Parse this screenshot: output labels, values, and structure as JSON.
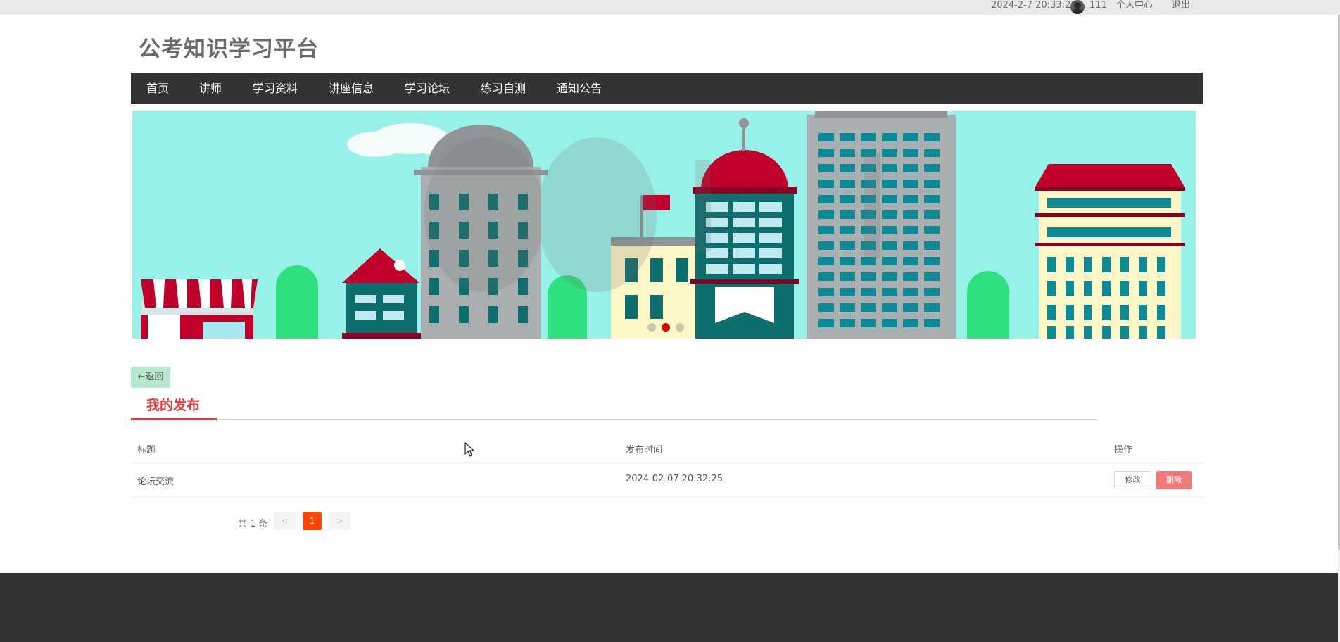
{
  "topbar": {
    "datetime": "2024-2-7 20:33:26",
    "username": "111",
    "profile_link": "个人中心",
    "logout_link": "退出"
  },
  "site": {
    "title": "公考知识学习平台"
  },
  "nav": {
    "items": [
      "首页",
      "讲师",
      "学习资料",
      "讲座信息",
      "学习论坛",
      "练习自测",
      "通知公告"
    ]
  },
  "banner": {
    "slide_count": 3,
    "active_slide": 2
  },
  "back_button": {
    "label": "←返回"
  },
  "section": {
    "title": "我的发布"
  },
  "table": {
    "columns": [
      "标题",
      "发布时间",
      "操作"
    ],
    "rows": [
      {
        "title": "论坛交流",
        "published": "2024-02-07 20:32:25",
        "edit_label": "修改",
        "delete_label": "删除"
      }
    ]
  },
  "pagination": {
    "total_text": "共 1 条",
    "prev_label": "<",
    "current_page": "1",
    "next_label": ">"
  },
  "colors": {
    "accent": "#e33b3b",
    "nav_bg": "#333333",
    "page_active": "#ff4500",
    "delete_button": "#ef7a7a",
    "back_button": "#b6e9cc",
    "banner_sky": "#98f1e8"
  }
}
